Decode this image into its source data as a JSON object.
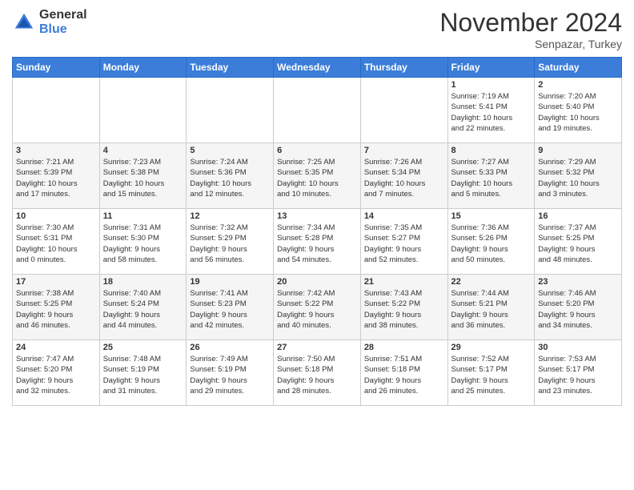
{
  "logo": {
    "general": "General",
    "blue": "Blue"
  },
  "title": "November 2024",
  "location": "Senpazar, Turkey",
  "days_of_week": [
    "Sunday",
    "Monday",
    "Tuesday",
    "Wednesday",
    "Thursday",
    "Friday",
    "Saturday"
  ],
  "weeks": [
    [
      {
        "day": "",
        "info": ""
      },
      {
        "day": "",
        "info": ""
      },
      {
        "day": "",
        "info": ""
      },
      {
        "day": "",
        "info": ""
      },
      {
        "day": "",
        "info": ""
      },
      {
        "day": "1",
        "info": "Sunrise: 7:19 AM\nSunset: 5:41 PM\nDaylight: 10 hours\nand 22 minutes."
      },
      {
        "day": "2",
        "info": "Sunrise: 7:20 AM\nSunset: 5:40 PM\nDaylight: 10 hours\nand 19 minutes."
      }
    ],
    [
      {
        "day": "3",
        "info": "Sunrise: 7:21 AM\nSunset: 5:39 PM\nDaylight: 10 hours\nand 17 minutes."
      },
      {
        "day": "4",
        "info": "Sunrise: 7:23 AM\nSunset: 5:38 PM\nDaylight: 10 hours\nand 15 minutes."
      },
      {
        "day": "5",
        "info": "Sunrise: 7:24 AM\nSunset: 5:36 PM\nDaylight: 10 hours\nand 12 minutes."
      },
      {
        "day": "6",
        "info": "Sunrise: 7:25 AM\nSunset: 5:35 PM\nDaylight: 10 hours\nand 10 minutes."
      },
      {
        "day": "7",
        "info": "Sunrise: 7:26 AM\nSunset: 5:34 PM\nDaylight: 10 hours\nand 7 minutes."
      },
      {
        "day": "8",
        "info": "Sunrise: 7:27 AM\nSunset: 5:33 PM\nDaylight: 10 hours\nand 5 minutes."
      },
      {
        "day": "9",
        "info": "Sunrise: 7:29 AM\nSunset: 5:32 PM\nDaylight: 10 hours\nand 3 minutes."
      }
    ],
    [
      {
        "day": "10",
        "info": "Sunrise: 7:30 AM\nSunset: 5:31 PM\nDaylight: 10 hours\nand 0 minutes."
      },
      {
        "day": "11",
        "info": "Sunrise: 7:31 AM\nSunset: 5:30 PM\nDaylight: 9 hours\nand 58 minutes."
      },
      {
        "day": "12",
        "info": "Sunrise: 7:32 AM\nSunset: 5:29 PM\nDaylight: 9 hours\nand 56 minutes."
      },
      {
        "day": "13",
        "info": "Sunrise: 7:34 AM\nSunset: 5:28 PM\nDaylight: 9 hours\nand 54 minutes."
      },
      {
        "day": "14",
        "info": "Sunrise: 7:35 AM\nSunset: 5:27 PM\nDaylight: 9 hours\nand 52 minutes."
      },
      {
        "day": "15",
        "info": "Sunrise: 7:36 AM\nSunset: 5:26 PM\nDaylight: 9 hours\nand 50 minutes."
      },
      {
        "day": "16",
        "info": "Sunrise: 7:37 AM\nSunset: 5:25 PM\nDaylight: 9 hours\nand 48 minutes."
      }
    ],
    [
      {
        "day": "17",
        "info": "Sunrise: 7:38 AM\nSunset: 5:25 PM\nDaylight: 9 hours\nand 46 minutes."
      },
      {
        "day": "18",
        "info": "Sunrise: 7:40 AM\nSunset: 5:24 PM\nDaylight: 9 hours\nand 44 minutes."
      },
      {
        "day": "19",
        "info": "Sunrise: 7:41 AM\nSunset: 5:23 PM\nDaylight: 9 hours\nand 42 minutes."
      },
      {
        "day": "20",
        "info": "Sunrise: 7:42 AM\nSunset: 5:22 PM\nDaylight: 9 hours\nand 40 minutes."
      },
      {
        "day": "21",
        "info": "Sunrise: 7:43 AM\nSunset: 5:22 PM\nDaylight: 9 hours\nand 38 minutes."
      },
      {
        "day": "22",
        "info": "Sunrise: 7:44 AM\nSunset: 5:21 PM\nDaylight: 9 hours\nand 36 minutes."
      },
      {
        "day": "23",
        "info": "Sunrise: 7:46 AM\nSunset: 5:20 PM\nDaylight: 9 hours\nand 34 minutes."
      }
    ],
    [
      {
        "day": "24",
        "info": "Sunrise: 7:47 AM\nSunset: 5:20 PM\nDaylight: 9 hours\nand 32 minutes."
      },
      {
        "day": "25",
        "info": "Sunrise: 7:48 AM\nSunset: 5:19 PM\nDaylight: 9 hours\nand 31 minutes."
      },
      {
        "day": "26",
        "info": "Sunrise: 7:49 AM\nSunset: 5:19 PM\nDaylight: 9 hours\nand 29 minutes."
      },
      {
        "day": "27",
        "info": "Sunrise: 7:50 AM\nSunset: 5:18 PM\nDaylight: 9 hours\nand 28 minutes."
      },
      {
        "day": "28",
        "info": "Sunrise: 7:51 AM\nSunset: 5:18 PM\nDaylight: 9 hours\nand 26 minutes."
      },
      {
        "day": "29",
        "info": "Sunrise: 7:52 AM\nSunset: 5:17 PM\nDaylight: 9 hours\nand 25 minutes."
      },
      {
        "day": "30",
        "info": "Sunrise: 7:53 AM\nSunset: 5:17 PM\nDaylight: 9 hours\nand 23 minutes."
      }
    ]
  ]
}
